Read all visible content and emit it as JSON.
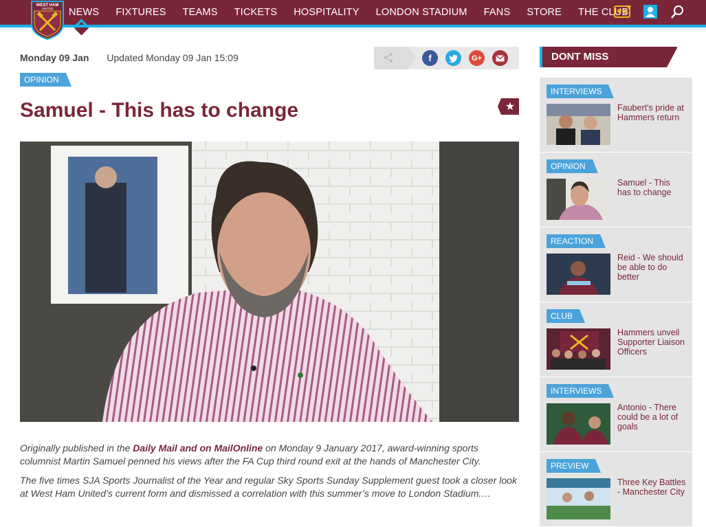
{
  "nav": {
    "items": [
      "NEWS",
      "FIXTURES",
      "TEAMS",
      "TICKETS",
      "HOSPITALITY",
      "LONDON STADIUM",
      "FANS",
      "STORE",
      "THE CLUB"
    ],
    "active": "NEWS",
    "crest_text": "WEST HAM UNITED",
    "icons": [
      "membership-card-icon",
      "account-icon",
      "search-icon"
    ]
  },
  "article": {
    "date": "Monday 09 Jan",
    "updated": "Updated Monday 09 Jan 15:09",
    "category": "OPINION",
    "title": "Samuel - This has to change",
    "share_icons": [
      "share-icon",
      "facebook-icon",
      "twitter-icon",
      "google-plus-icon",
      "email-icon"
    ],
    "p1_prefix": "Originally published in the ",
    "p1_link": "Daily Mail and on MailOnline",
    "p1_suffix": " on Monday 9 January 2017, award-winning sports columnist Martin Samuel penned his views after the FA Cup third round exit at the hands of Manchester City.",
    "p2": "The five times SJA Sports Journalist of the Year and regular Sky Sports Sunday Supplement guest took a closer look at West Ham United’s current form and dismissed a correlation with this summer’s move to London Stadium.…"
  },
  "sidebar": {
    "heading": "DONT MISS",
    "items": [
      {
        "category": "INTERVIEWS",
        "title": "Faubert's pride at Hammers return"
      },
      {
        "category": "OPINION",
        "title": "Samuel - This has to change"
      },
      {
        "category": "REACTION",
        "title": "Reid - We should be able to do better"
      },
      {
        "category": "CLUB",
        "title": "Hammers unveil Supporter Liaison Officers"
      },
      {
        "category": "INTERVIEWS",
        "title": "Antonio - There could be a lot of goals"
      },
      {
        "category": "PREVIEW",
        "title": "Three Key Battles - Manchester City"
      }
    ]
  },
  "colors": {
    "claret": "#7a263a",
    "sky_blue": "#1bb1e7",
    "badge_blue": "#4ba3d9"
  }
}
